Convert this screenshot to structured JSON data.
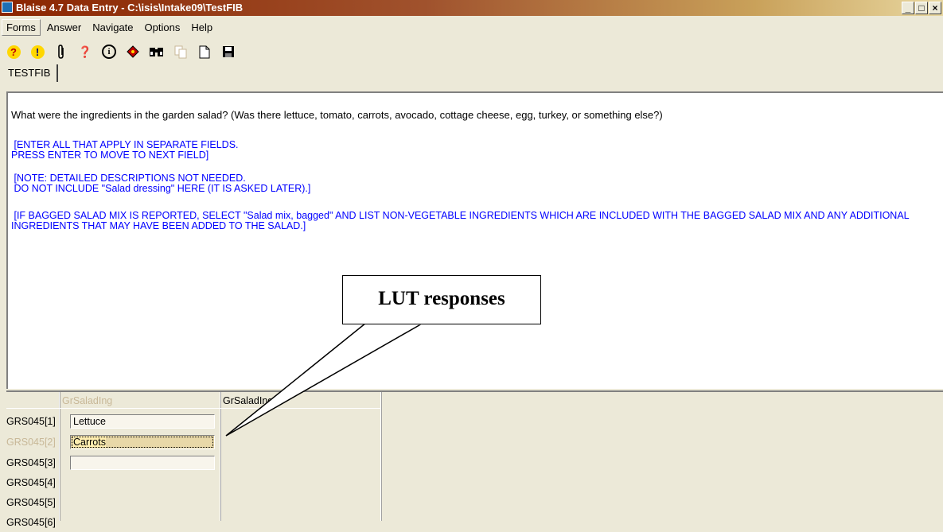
{
  "window": {
    "title": "Blaise 4.7 Data Entry - C:\\isis\\Intake09\\TestFIB",
    "controls": [
      "_",
      "□",
      "×"
    ]
  },
  "menu": {
    "forms": "Forms",
    "answer": "Answer",
    "navigate": "Navigate",
    "options": "Options",
    "help": "Help"
  },
  "toolbar": {
    "icons": [
      "help-question-icon",
      "alert-exclamation-icon",
      "paperclip-icon",
      "dont-know-icon",
      "info-icon",
      "tag-icon",
      "search-binoculars-icon",
      "copy-icon",
      "new-document-icon",
      "save-disk-icon"
    ]
  },
  "tab": {
    "label": "TESTFIB"
  },
  "question": {
    "text": "What were the ingredients in the garden salad?  (Was there lettuce, tomato, carrots, avocado, cottage cheese, egg, turkey, or something else?)",
    "instr1_line1": " [ENTER ALL THAT APPLY IN SEPARATE FIELDS.",
    "instr1_line2": "PRESS ENTER TO MOVE TO NEXT FIELD]",
    "instr2_line1": " [NOTE: DETAILED DESCRIPTIONS NOT NEEDED.",
    "instr2_line2": " DO NOT INCLUDE \"Salad dressing\" HERE (IT IS ASKED LATER).]",
    "instr3_line1": " [IF BAGGED SALAD MIX IS REPORTED, SELECT \"Salad mix, bagged\" AND LIST NON-VEGETABLE INGREDIENTS WHICH ARE INCLUDED WITH THE BAGGED SALAD MIX AND ANY ADDITIONAL",
    "instr3_line2": "INGREDIENTS THAT MAY HAVE BEEN ADDED TO THE SALAD.]"
  },
  "grid": {
    "col1_header": "GrSaladIng",
    "col2_header": "GrSaladIngO",
    "rows": [
      {
        "label": "GRS045[1]",
        "value": "Lettuce"
      },
      {
        "label": "GRS045[2]",
        "value": "Carrots"
      },
      {
        "label": "GRS045[3]",
        "value": ""
      },
      {
        "label": "GRS045[4]"
      },
      {
        "label": "GRS045[5]"
      },
      {
        "label": "GRS045[6]"
      }
    ]
  },
  "callout": {
    "text": "LUT responses"
  },
  "colors": {
    "title_gradient_start": "#8B2500",
    "instruction_blue": "#0000FF",
    "background": "#ECE9D8"
  }
}
